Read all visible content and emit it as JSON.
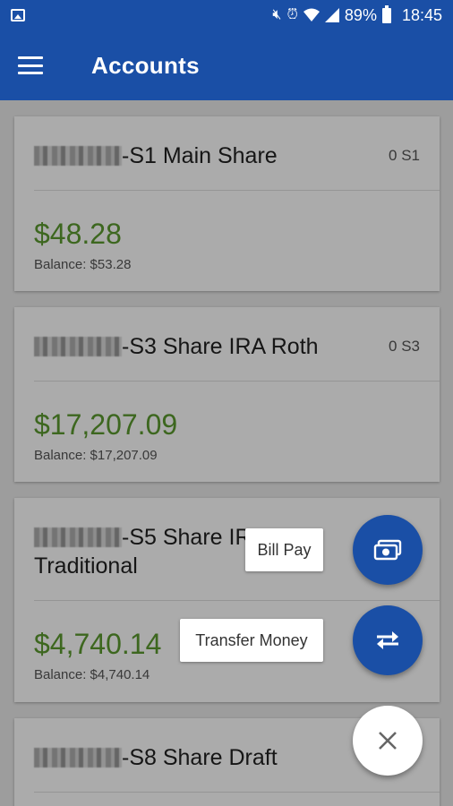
{
  "status_bar": {
    "battery": "89%",
    "time": "18:45",
    "icons": [
      "image-icon",
      "mute-icon",
      "alarm-icon",
      "wifi-icon",
      "signal-icon",
      "battery-icon"
    ]
  },
  "app_bar": {
    "title": "Accounts",
    "menu_icon": "hamburger-menu-icon",
    "color": "#1a4fa6"
  },
  "accounts": [
    {
      "name_suffix": "-S1 Main Share",
      "code": "0 S1",
      "available": "$48.28",
      "balance": "Balance: $53.28"
    },
    {
      "name_suffix": "-S3 Share IRA Roth",
      "code": "0 S3",
      "available": "$17,207.09",
      "balance": "Balance: $17,207.09"
    },
    {
      "name_suffix": "-S5 Share IRA",
      "name_line2": "Traditional",
      "code": "",
      "available": "$4,740.14",
      "balance": "Balance: $4,740.14"
    },
    {
      "name_suffix": "-S8 Share Draft",
      "code": ""
    }
  ],
  "fab_menu": {
    "bill_pay": "Bill Pay",
    "transfer_money": "Transfer Money",
    "bill_pay_icon": "money-bill-icon",
    "transfer_icon": "swap-arrows-icon",
    "close_icon": "close-icon"
  },
  "colors": {
    "accent": "#1a4fa6",
    "amount_green": "#5b9a2f"
  }
}
